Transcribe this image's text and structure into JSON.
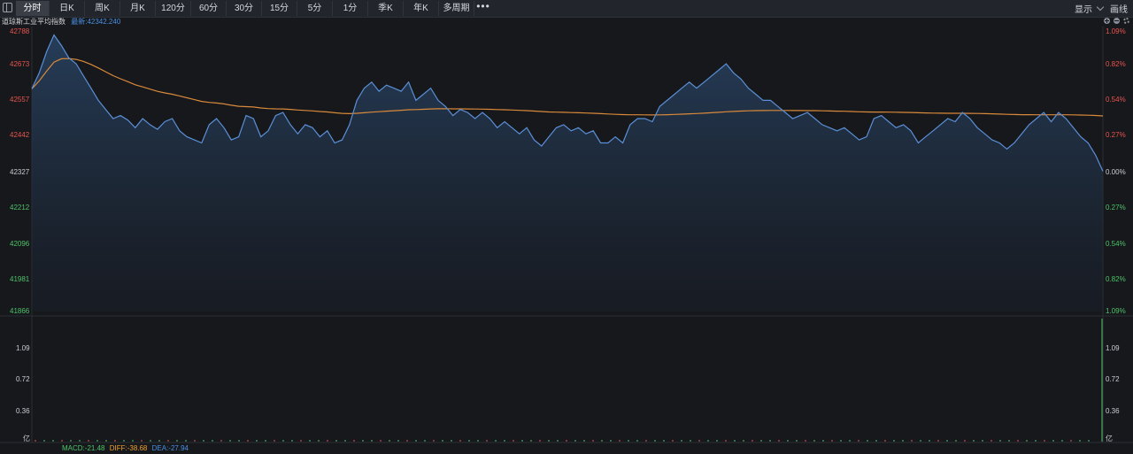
{
  "toolbar": {
    "tabs": [
      {
        "label": "分时",
        "active": true
      },
      {
        "label": "日K"
      },
      {
        "label": "周K"
      },
      {
        "label": "月K"
      },
      {
        "label": "120分"
      },
      {
        "label": "60分"
      },
      {
        "label": "30分"
      },
      {
        "label": "15分"
      },
      {
        "label": "5分"
      },
      {
        "label": "1分"
      },
      {
        "label": "季K"
      },
      {
        "label": "年K"
      },
      {
        "label": "多周期"
      }
    ],
    "more_label": "•••",
    "display_label": "显示",
    "draw_label": "画线"
  },
  "info": {
    "index_name": "道琼斯工业平均指数",
    "latest_label": "最新:42342.240"
  },
  "price_axis": {
    "left": [
      "42788",
      "42673",
      "42557",
      "42442",
      "42327",
      "42212",
      "42096",
      "41981",
      "41866"
    ],
    "right": [
      "1.09%",
      "0.82%",
      "0.54%",
      "0.27%",
      "0.00%",
      "0.27%",
      "0.54%",
      "0.82%",
      "1.09%"
    ]
  },
  "volume_axis": {
    "left": [
      "1.09",
      "0.72",
      "0.36",
      "亿"
    ],
    "right": [
      "1.09",
      "0.72",
      "0.36",
      "亿"
    ]
  },
  "macd": {
    "macd_label": "MACD:-21.48",
    "diff_label": "DIFF:-38.68",
    "dea_label": "DEA:-27.94"
  },
  "colors": {
    "price_line": "#5b8fd6",
    "avg_line": "#d9893a",
    "up": "#e8544f",
    "down": "#4fc36a"
  },
  "chart_data": {
    "type": "line",
    "ylim": [
      41866,
      42788
    ],
    "base": 42327,
    "series": [
      {
        "values": [
          42598,
          42650,
          42720,
          42775,
          42740,
          42700,
          42680,
          42640,
          42600,
          42560,
          42530,
          42500,
          42510,
          42495,
          42470,
          42500,
          42480,
          42465,
          42490,
          42500,
          42460,
          42440,
          42430,
          42420,
          42480,
          42500,
          42470,
          42430,
          42440,
          42510,
          42500,
          42440,
          42460,
          42510,
          42520,
          42480,
          42450,
          42480,
          42470,
          42440,
          42460,
          42420,
          42430,
          42480,
          42560,
          42600,
          42620,
          42590,
          42610,
          42600,
          42590,
          42620,
          42560,
          42580,
          42600,
          42560,
          42540,
          42510,
          42530,
          42520,
          42500,
          42520,
          42500,
          42470,
          42490,
          42470,
          42450,
          42470,
          42430,
          42410,
          42440,
          42470,
          42480,
          42460,
          42470,
          42450,
          42460,
          42420,
          42420,
          42440,
          42420,
          42480,
          42500,
          42500,
          42490,
          42540,
          42560,
          42580,
          42600,
          42620,
          42600,
          42620,
          42640,
          42660,
          42680,
          42650,
          42630,
          42600,
          42580,
          42560,
          42560,
          42540,
          42520,
          42500,
          42510,
          42520,
          42500,
          42480,
          42470,
          42460,
          42470,
          42450,
          42430,
          42440,
          42500,
          42510,
          42490,
          42470,
          42480,
          42460,
          42420,
          42440,
          42460,
          42480,
          42500,
          42490,
          42520,
          42500,
          42470,
          42450,
          42430,
          42420,
          42400,
          42420,
          42450,
          42480,
          42500,
          42520,
          42490,
          42520,
          42500,
          42470,
          42440,
          42420,
          42380,
          42327
        ]
      }
    ]
  }
}
